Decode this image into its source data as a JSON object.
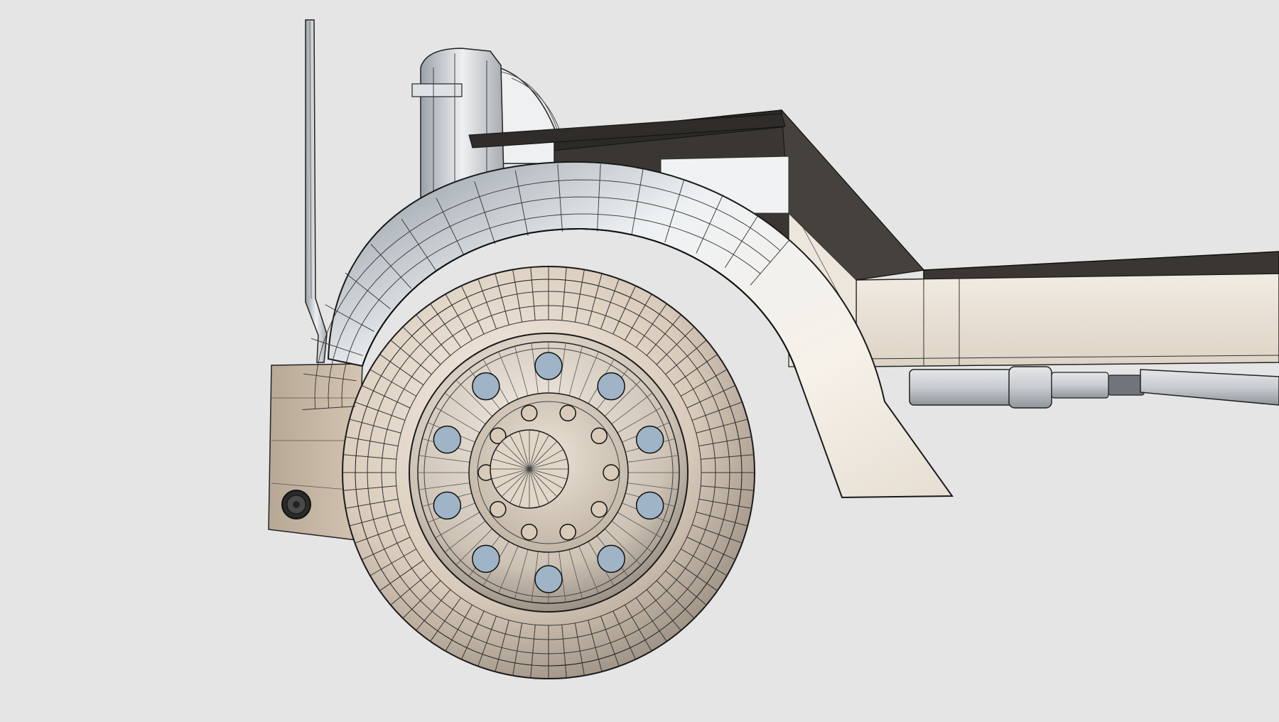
{
  "viewport": {
    "background": "#e5e5e5",
    "render_mode": "shaded-with-edges",
    "model_color": "#ece4d8",
    "edge_color": "#1a1a1a",
    "frame_top_color": "#3a3733"
  },
  "model": {
    "parts": [
      "wheel",
      "rim",
      "hub",
      "fender",
      "mud-flap",
      "tail-light",
      "exhaust-stack",
      "air-intake",
      "frame-rail",
      "cross-member",
      "drive-shaft"
    ]
  }
}
